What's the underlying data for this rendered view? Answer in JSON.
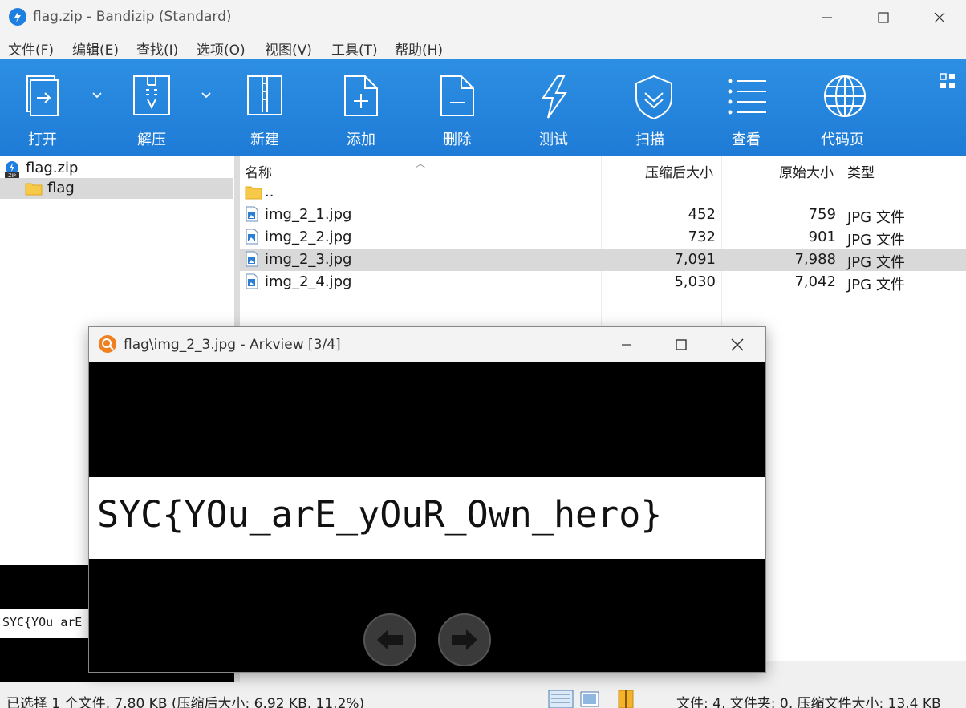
{
  "window": {
    "title": "flag.zip - Bandizip (Standard)"
  },
  "menu": [
    "文件(F)",
    "编辑(E)",
    "查找(I)",
    "选项(O)",
    "视图(V)",
    "工具(T)",
    "帮助(H)"
  ],
  "toolbar": {
    "open": "打开",
    "extract": "解压",
    "new": "新建",
    "add": "添加",
    "delete": "删除",
    "test": "测试",
    "scan": "扫描",
    "view": "查看",
    "codepage": "代码页"
  },
  "tree": {
    "root": "flag.zip",
    "folder": "flag"
  },
  "columns": {
    "name": "名称",
    "compressed": "压缩后大小",
    "original": "原始大小",
    "type": "类型"
  },
  "files": [
    {
      "name": "..",
      "compressed": "",
      "original": "",
      "type": ""
    },
    {
      "name": "img_2_1.jpg",
      "compressed": "452",
      "original": "759",
      "type": "JPG 文件"
    },
    {
      "name": "img_2_2.jpg",
      "compressed": "732",
      "original": "901",
      "type": "JPG 文件"
    },
    {
      "name": "img_2_3.jpg",
      "compressed": "7,091",
      "original": "7,988",
      "type": "JPG 文件"
    },
    {
      "name": "img_2_4.jpg",
      "compressed": "5,030",
      "original": "7,042",
      "type": "JPG 文件"
    }
  ],
  "preview_strip_text": "SYC{YOu_arE",
  "status": {
    "left": "已选择 1 个文件, 7.80 KB (压缩后大小: 6.92 KB, 11.2%)",
    "right": "文件: 4, 文件夹: 0, 压缩文件大小: 13.4 KB"
  },
  "arkview": {
    "title": "flag\\img_2_3.jpg - Arkview [3/4]",
    "image_text": "SYC{YOu_arE_yOuR_Own_hero}"
  }
}
